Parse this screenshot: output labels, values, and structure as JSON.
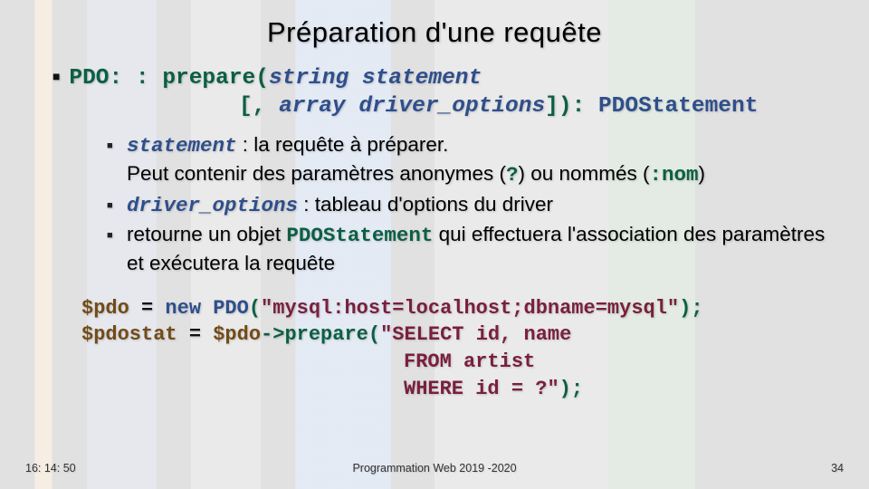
{
  "title": "Préparation d'une requête",
  "signature": {
    "name": "PDO: : prepare",
    "param1_type": "string",
    "param1_name": "statement",
    "opt_open": "[,",
    "param2_type": "array",
    "param2_name": "driver_options",
    "opt_close": "]):",
    "return_type": "PDOStatement"
  },
  "bullets": {
    "b1_code": "statement",
    "b1_text_a": " : la requête à préparer.",
    "b1_text_b": "Peut contenir des paramètres anonymes (",
    "b1_q": "?",
    "b1_text_c": ") ou nommés (",
    "b1_nom": ":nom",
    "b1_text_d": ")",
    "b2_code": "driver_options",
    "b2_text": " : tableau d'options du driver",
    "b3_text_a": "retourne un objet ",
    "b3_code": "PDOStatement",
    "b3_text_b": " qui effectuera l'association des paramètres et exécutera la requête"
  },
  "code": {
    "l1_var": "$pdo",
    "l1_eq": " = ",
    "l1_new": "new ",
    "l1_cls": "PDO",
    "l1_po": "(",
    "l1_q1": "\"",
    "l1_str": "mysql:host=localhost;dbname=mysql",
    "l1_q2": "\"",
    "l1_pc": ");",
    "l2_var": "$pdostat",
    "l2_eq": " = ",
    "l2_obj": "$pdo",
    "l2_arrow": "->",
    "l2_fn": "prepare",
    "l2_po": "(",
    "l2_q1": "\"",
    "l2_s1": "SELECT id, name",
    "l3_s": "FROM artist",
    "l4_s": "WHERE id = ?",
    "l4_q2": "\"",
    "l4_pc": ");"
  },
  "footer": {
    "time": "16: 14: 50",
    "course": "Programmation Web 2019 -2020",
    "page": "34"
  }
}
